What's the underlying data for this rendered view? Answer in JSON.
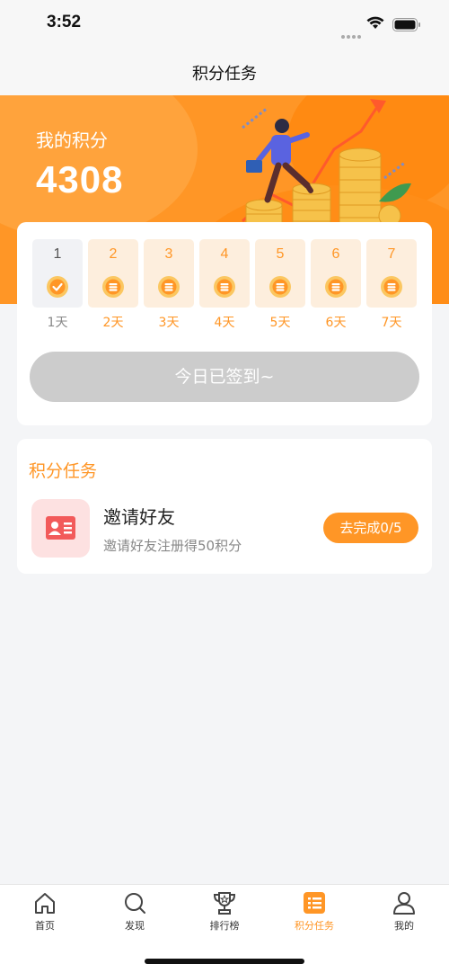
{
  "status": {
    "time": "3:52"
  },
  "nav": {
    "title": "积分任务"
  },
  "banner": {
    "label": "我的积分",
    "points": "4308"
  },
  "checkin": {
    "days": [
      {
        "num": "1",
        "label": "1天",
        "done": true
      },
      {
        "num": "2",
        "label": "2天",
        "done": false
      },
      {
        "num": "3",
        "label": "3天",
        "done": false
      },
      {
        "num": "4",
        "label": "4天",
        "done": false
      },
      {
        "num": "5",
        "label": "5天",
        "done": false
      },
      {
        "num": "6",
        "label": "6天",
        "done": false
      },
      {
        "num": "7",
        "label": "7天",
        "done": false
      }
    ],
    "button_label": "今日已签到~"
  },
  "tasks": {
    "section_title": "积分任务",
    "items": [
      {
        "title": "邀请好友",
        "desc": "邀请好友注册得50积分",
        "button_label": "去完成0/5",
        "icon": "id-card-icon"
      }
    ]
  },
  "tabbar": {
    "items": [
      {
        "label": "首页",
        "icon": "home-icon",
        "active": false
      },
      {
        "label": "发现",
        "icon": "search-icon",
        "active": false
      },
      {
        "label": "排行榜",
        "icon": "trophy-icon",
        "active": false
      },
      {
        "label": "积分任务",
        "icon": "task-list-icon",
        "active": true
      },
      {
        "label": "我的",
        "icon": "user-icon",
        "active": false
      }
    ]
  },
  "colors": {
    "accent": "#ff9626",
    "banner": "#ff9626",
    "disabled": "#cccccc",
    "icon_bg": "#fde1e1",
    "icon_red": "#f25a5a"
  }
}
